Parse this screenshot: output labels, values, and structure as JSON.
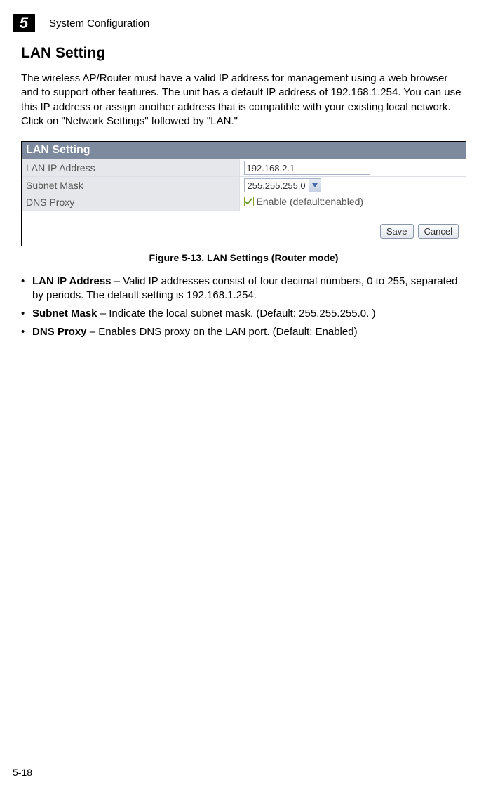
{
  "header": {
    "chapter_number": "5",
    "chapter_title": "System Configuration"
  },
  "section": {
    "heading": "LAN Setting",
    "intro": "The wireless AP/Router must have a valid IP address for management using a web browser and to support other features. The unit has a default IP address of 192.168.1.254. You can use this IP address or assign another address that is compatible with your existing local network. Click on \"Network Settings\" followed by \"LAN.\""
  },
  "figure": {
    "title_bar": "LAN Setting",
    "rows": {
      "lan_ip_label": "LAN IP Address",
      "lan_ip_value": "192.168.2.1",
      "subnet_label": "Subnet Mask",
      "subnet_value": "255.255.255.0",
      "dns_label": "DNS Proxy",
      "dns_checkbox_label": "Enable (default:enabled)"
    },
    "buttons": {
      "save": "Save",
      "cancel": "Cancel"
    },
    "caption": "Figure 5-13.   LAN Settings (Router mode)"
  },
  "bullets": [
    {
      "term": "LAN IP Address",
      "desc": " – Valid IP addresses consist of four decimal numbers, 0 to 255, separated by periods. The default setting is 192.168.1.254."
    },
    {
      "term": "Subnet Mask",
      "desc": " – Indicate the local subnet mask. (Default: 255.255.255.0. )"
    },
    {
      "term": "DNS Proxy",
      "desc": " – Enables DNS proxy on the LAN port. (Default: Enabled)"
    }
  ],
  "footer": {
    "page_number": "5-18"
  }
}
